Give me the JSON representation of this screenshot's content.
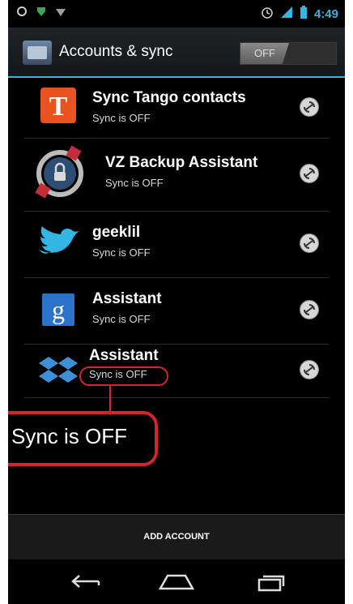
{
  "status_bar": {
    "time": "4:49",
    "left_icons": [
      "notification-circle-icon",
      "shield-icon",
      "wifi-icon"
    ],
    "right_icons": [
      "alarm-icon",
      "signal-icon",
      "battery-icon"
    ]
  },
  "action_bar": {
    "title": "Accounts & sync",
    "toggle_label": "OFF",
    "toggle_state": "off",
    "icon": "accounts-settings-icon"
  },
  "accounts": [
    {
      "name": "Sync Tango contacts",
      "status": "Sync is OFF",
      "icon": "tango-icon"
    },
    {
      "name": "VZ Backup Assistant",
      "status": "Sync is OFF",
      "icon": "vz-backup-icon"
    },
    {
      "name": "geeklil",
      "status": "Sync is OFF",
      "icon": "twitter-bird-icon"
    },
    {
      "name": "Assistant",
      "status": "Sync is OFF",
      "icon": "google-icon"
    },
    {
      "name": "Assistant",
      "status": "Sync is OFF",
      "icon": "dropbox-icon"
    }
  ],
  "callout": {
    "text": "Sync is OFF"
  },
  "bottom": {
    "add_account_label": "ADD ACCOUNT"
  },
  "nav_bar": {
    "buttons": [
      "back-icon",
      "home-icon",
      "recent-apps-icon"
    ]
  },
  "colors": {
    "accent": "#33b5e5",
    "callout": "#d6242b",
    "background": "#000000"
  }
}
